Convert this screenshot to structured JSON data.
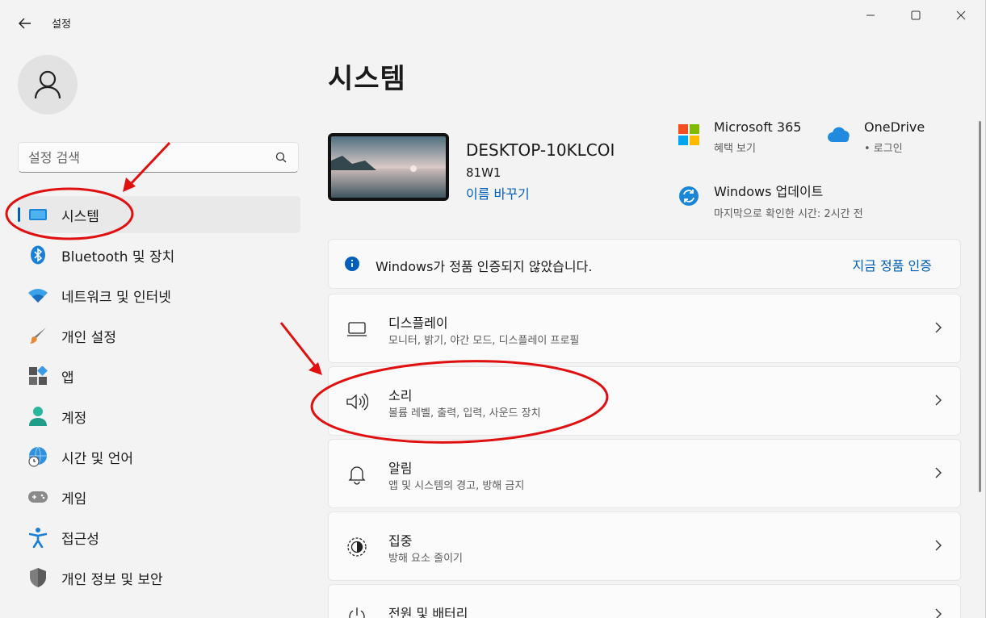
{
  "window": {
    "title": "설정"
  },
  "sidebar": {
    "search_placeholder": "설정 검색",
    "items": [
      {
        "label": "시스템",
        "icon": "system-icon"
      },
      {
        "label": "Bluetooth 및 장치",
        "icon": "bluetooth-icon"
      },
      {
        "label": "네트워크 및 인터넷",
        "icon": "wifi-icon"
      },
      {
        "label": "개인 설정",
        "icon": "paintbrush-icon"
      },
      {
        "label": "앱",
        "icon": "apps-icon"
      },
      {
        "label": "계정",
        "icon": "account-icon"
      },
      {
        "label": "시간 및 언어",
        "icon": "globe-clock-icon"
      },
      {
        "label": "게임",
        "icon": "gamepad-icon"
      },
      {
        "label": "접근성",
        "icon": "accessibility-icon"
      },
      {
        "label": "개인 정보 및 보안",
        "icon": "shield-icon"
      }
    ]
  },
  "main": {
    "title": "시스템",
    "device": {
      "name": "DESKTOP-10KLCOI",
      "model": "81W1",
      "rename": "이름 바꾸기"
    },
    "quick": {
      "ms365": {
        "title": "Microsoft 365",
        "sub": "혜택 보기"
      },
      "onedrive": {
        "title": "OneDrive",
        "sub": "• 로그인"
      },
      "update": {
        "title": "Windows 업데이트",
        "sub": "마지막으로 확인한 시간: 2시간 전"
      }
    },
    "activation": {
      "text": "Windows가 정품 인증되지 않았습니다.",
      "button": "지금 정품 인증"
    },
    "cards": [
      {
        "title": "디스플레이",
        "sub": "모니터, 밝기, 야간 모드, 디스플레이 프로필",
        "icon": "display-icon"
      },
      {
        "title": "소리",
        "sub": "볼륨 레벨, 출력, 입력, 사운드 장치",
        "icon": "speaker-icon"
      },
      {
        "title": "알림",
        "sub": "앱 및 시스템의 경고, 방해 금지",
        "icon": "bell-icon"
      },
      {
        "title": "집중",
        "sub": "방해 요소 줄이기",
        "icon": "focus-icon"
      },
      {
        "title": "전원 및 배터리",
        "sub": "",
        "icon": "power-icon"
      }
    ]
  },
  "colors": {
    "accent": "#005fb8",
    "annotation": "#e01010"
  }
}
